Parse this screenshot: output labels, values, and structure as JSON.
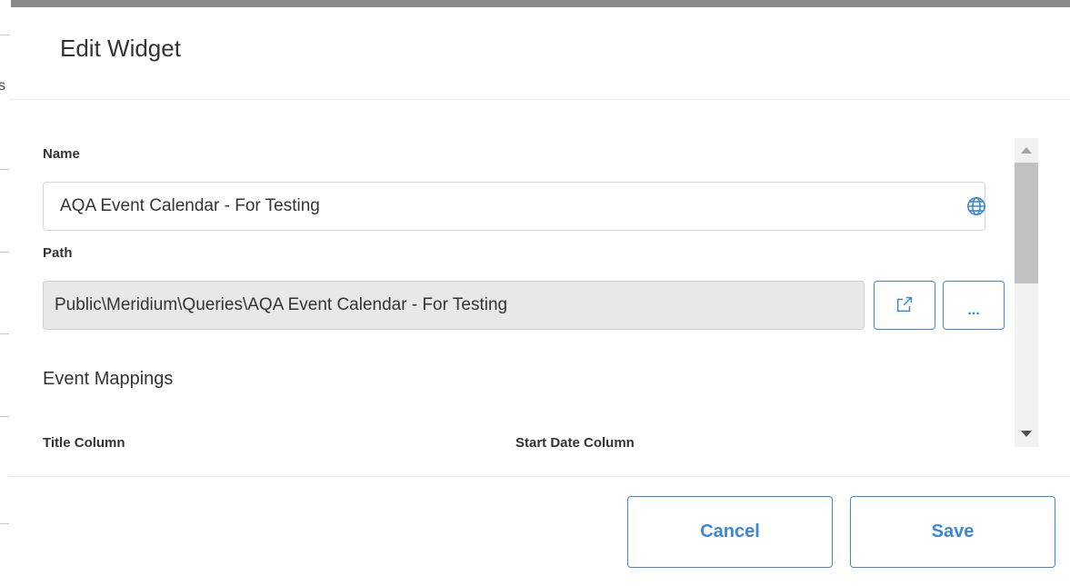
{
  "backdrop": {
    "partial_char": "s"
  },
  "dialog": {
    "title": "Edit Widget",
    "name_field": {
      "label": "Name",
      "value": "AQA Event Calendar - For Testing",
      "globe_icon": "globe-icon"
    },
    "path_field": {
      "label": "Path",
      "value": "Public\\Meridium\\Queries\\AQA Event Calendar - For Testing",
      "open_icon": "external-link-icon",
      "browse_label": "..."
    },
    "event_mappings": {
      "heading": "Event Mappings",
      "title_column_label": "Title Column",
      "start_date_column_label": "Start Date Column"
    },
    "footer": {
      "cancel_label": "Cancel",
      "save_label": "Save"
    }
  },
  "colors": {
    "accent": "#3b86d6",
    "readonly_bg": "#e8e8e8",
    "overlay": "#8a8a8a"
  }
}
